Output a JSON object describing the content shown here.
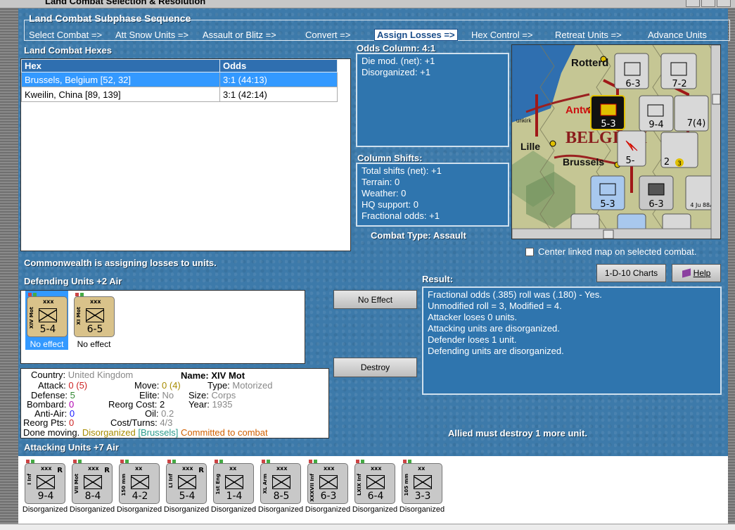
{
  "window": {
    "title": "Land Combat Selection & Resolution"
  },
  "sequence": {
    "title": "Land Combat Subphase Sequence",
    "steps": [
      "Select Combat =>",
      "Att Snow Units =>",
      "Assault or Blitz =>",
      "Convert =>",
      "Assign Losses =>",
      "Hex Control =>",
      "Retreat Units =>",
      "Advance Units"
    ],
    "active": "Assign Losses =>"
  },
  "hexes": {
    "title": "Land Combat Hexes",
    "columns": [
      "Hex",
      "Odds"
    ],
    "rows": [
      {
        "hex": "Brussels, Belgium [52, 32]",
        "odds": "3:1 (44:13)"
      },
      {
        "hex": "Kweilin, China [89, 139]",
        "odds": "3:1 (42:14)"
      }
    ]
  },
  "odds": {
    "title": "Odds Column: 4:1",
    "lines": [
      "Die mod. (net): +1",
      "Disorganized: +1"
    ]
  },
  "shifts": {
    "title": "Column Shifts:",
    "lines": [
      "Total shifts (net): +1",
      "Terrain: 0",
      "Weather: 0",
      "HQ support: 0",
      "Fractional odds: +1"
    ]
  },
  "combat_type": "Combat Type:  Assault",
  "map": {
    "labels": {
      "rotterdam": "Rotterd",
      "antwerp": "Antw",
      "belgium": "BELGIUM",
      "lille": "Lille",
      "brussels": "Brussels",
      "dunkirk": "unkirk"
    },
    "counters": [
      "6-3",
      "7-2",
      "5-3",
      "9-4",
      "7(4)",
      "5-",
      "2",
      "3",
      "5-3",
      "6-3",
      "4 Ju 88A"
    ]
  },
  "center_linked": {
    "label": "Center linked map on selected combat.",
    "checked": false
  },
  "status": "Commonwealth is assigning losses to units.",
  "buttons": {
    "charts": "1-D-10 Charts",
    "help": "Help",
    "no_effect": "No Effect",
    "destroy": "Destroy"
  },
  "defending": {
    "title": "Defending Units +2 Air",
    "units": [
      {
        "name": "XIV Mot",
        "size": "xxx",
        "value": "5-4",
        "label": "No effect",
        "selected": true
      },
      {
        "name": "XI Mot",
        "size": "xxx",
        "value": "6-5",
        "label": "No effect",
        "selected": false
      }
    ]
  },
  "detail": {
    "country_label": "Country:",
    "country": "United Kingdom",
    "name_label": "Name:",
    "name": "XIV Mot",
    "attack_label": "Attack:",
    "attack": "0",
    "attack_paren": "(5)",
    "move_label": "Move:",
    "move": "0 (4)",
    "type_label": "Type:",
    "type": "Motorized",
    "defense_label": "Defense:",
    "defense": "5",
    "elite_label": "Elite:",
    "elite": "No",
    "size_label": "Size:",
    "size": "Corps",
    "bombard_label": "Bombard:",
    "bombard": "0",
    "reorg_cost_label": "Reorg Cost:",
    "reorg_cost": "2",
    "year_label": "Year:",
    "year": "1935",
    "antiair_label": "Anti-Air:",
    "antiair": "0",
    "oil_label": "Oil:",
    "oil": "0.2",
    "reorg_pts_label": "Reorg Pts:",
    "reorg_pts": "0",
    "cost_turns_label": "Cost/Turns:",
    "cost_turns": "4/3",
    "status_done": "Done moving.",
    "status_disorg": "Disorganized",
    "status_hex": "[Brussels]",
    "status_committed": "Committed to combat"
  },
  "result": {
    "title": "Result:",
    "lines": [
      "Fractional odds (.385) roll was (.180)  - Yes.",
      "Unmodified roll = 3, Modified = 4.",
      "Attacker loses 0 units.",
      "Attacking units are disorganized.",
      "Defender loses 1 unit.",
      "Defending units are disorganized."
    ]
  },
  "must_destroy": "Allied must destroy 1 more unit.",
  "attacking": {
    "title": "Attacking Units +7 Air",
    "units": [
      {
        "name": "I Inf",
        "size": "xxx",
        "value": "9-4",
        "r": "R",
        "label": "Disorganized"
      },
      {
        "name": "VII Mot",
        "size": "xxx",
        "value": "8-4",
        "r": "R",
        "label": "Disorganized"
      },
      {
        "name": "150 mm",
        "size": "xx",
        "value": "4-2",
        "r": "",
        "label": "Disorganized"
      },
      {
        "name": "LI Inf",
        "size": "xxx",
        "value": "5-4",
        "r": "R",
        "label": "Disorganized"
      },
      {
        "name": "1st Eng",
        "size": "xx",
        "value": "1-4",
        "r": "",
        "label": "Disorganized"
      },
      {
        "name": "XL Arm",
        "size": "xxx",
        "value": "8-5",
        "r": "",
        "label": "Disorganized"
      },
      {
        "name": "XXXVII Inf",
        "size": "xxx",
        "value": "6-3",
        "r": "",
        "label": "Disorganized"
      },
      {
        "name": "LXIX Inf",
        "size": "xxx",
        "value": "6-4",
        "r": "",
        "label": "Disorganized"
      },
      {
        "name": "105 mm",
        "size": "xx",
        "value": "3-3",
        "r": "",
        "label": "Disorganized"
      }
    ]
  },
  "colors": {
    "panel": "#3d7aaa",
    "highlight": "#3399ff",
    "defender_counter": "#d9c28a",
    "attacker_counter": "#c8c8c8"
  }
}
